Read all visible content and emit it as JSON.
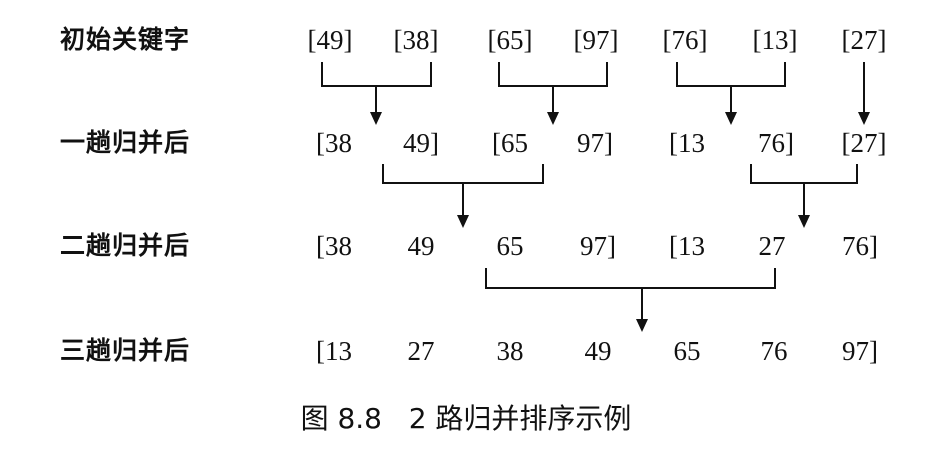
{
  "rows": [
    {
      "label": "初始关键字",
      "keys": [
        "[49]",
        "[38]",
        "[65]",
        "[97]",
        "[76]",
        "[13]",
        "[27]"
      ]
    },
    {
      "label": "一趟归并后",
      "keys": [
        "[38",
        "49]",
        "[65",
        "97]",
        "[13",
        "76]",
        "[27]"
      ]
    },
    {
      "label": "二趟归并后",
      "keys": [
        "[38",
        "49",
        "65",
        "97]",
        "[13",
        "27",
        "76]"
      ]
    },
    {
      "label": "三趟归并后",
      "keys": [
        "[13",
        "27",
        "38",
        "49",
        "65",
        "76",
        "97]"
      ]
    }
  ],
  "caption": "图 8.8   2 路归并排序示例"
}
